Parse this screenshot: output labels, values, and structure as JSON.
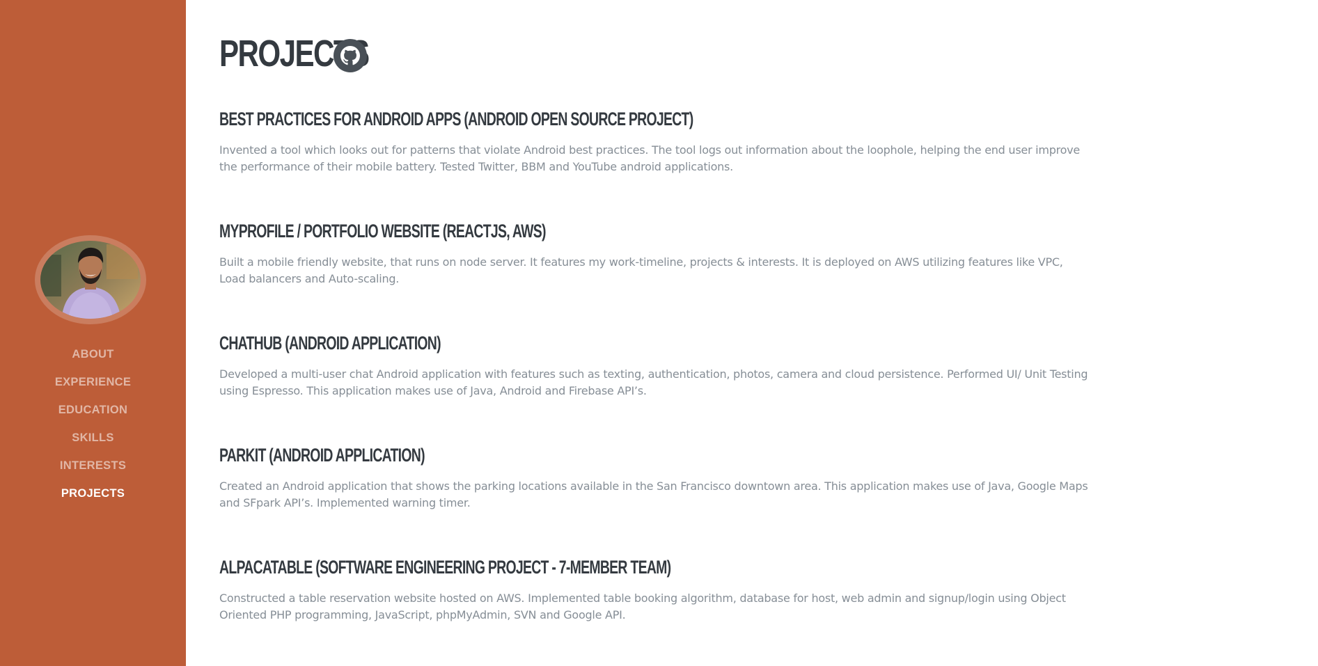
{
  "sidebar": {
    "avatar_alt": "profile photo",
    "nav": [
      {
        "label": "ABOUT",
        "active": false
      },
      {
        "label": "EXPERIENCE",
        "active": false
      },
      {
        "label": "EDUCATION",
        "active": false
      },
      {
        "label": "SKILLS",
        "active": false
      },
      {
        "label": "INTERESTS",
        "active": false
      },
      {
        "label": "PROJECTS",
        "active": true
      }
    ]
  },
  "main": {
    "title": "PROJECTS",
    "title_icon": "github-icon",
    "projects": [
      {
        "title": "BEST PRACTICES FOR ANDROID APPS (ANDROID OPEN SOURCE PROJECT)",
        "description": "Invented a tool which looks out for patterns that violate Android best practices. The tool logs out information about the loophole, helping the end user improve the performance of their mobile battery. Tested Twitter, BBM and YouTube android applications."
      },
      {
        "title": "MYPROFILE / PORTFOLIO WEBSITE (REACTJS, AWS)",
        "description": "Built a mobile friendly website, that runs on node server. It features my work-timeline, projects & interests. It is deployed on AWS utilizing features like VPC, Load balancers and Auto-scaling."
      },
      {
        "title": "CHATHUB (ANDROID APPLICATION)",
        "description": "Developed a multi-user chat Android application with features such as texting, authentication, photos, camera and cloud persistence. Performed UI/ Unit Testing using Espresso. This application makes use of Java, Android and Firebase API’s."
      },
      {
        "title": "PARKIT (ANDROID APPLICATION)",
        "description": "Created an Android application that shows the parking locations available in the San Francisco downtown area. This application makes use of Java, Google Maps and SFpark API’s. Implemented warning timer."
      },
      {
        "title": "ALPACATABLE (SOFTWARE ENGINEERING PROJECT - 7-MEMBER TEAM)",
        "description": "Constructed a table reservation website hosted on AWS. Implemented table booking algorithm, database for host, web admin and signup/login using Object Oriented PHP programming, JavaScript, phpMyAdmin, SVN and Google API."
      }
    ]
  },
  "colors": {
    "sidebar_bg": "#bd5d38",
    "heading": "#343a40",
    "body_text": "#868e96",
    "icon_bg": "#495057"
  }
}
